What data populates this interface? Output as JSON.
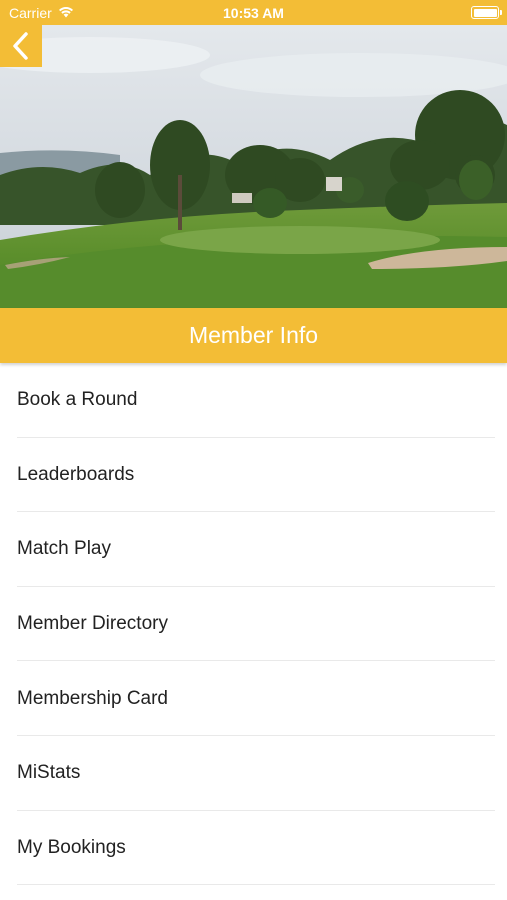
{
  "status_bar": {
    "carrier": "Carrier",
    "time": "10:53 AM"
  },
  "icons": {
    "wifi": "wifi-icon",
    "battery": "battery-icon",
    "back": "chevron-left-icon"
  },
  "colors": {
    "accent": "#f3bd36",
    "text": "#222222",
    "divider": "#e9e9e9"
  },
  "header": {
    "title": "Member Info"
  },
  "menu": {
    "items": [
      {
        "label": "Book a Round"
      },
      {
        "label": "Leaderboards"
      },
      {
        "label": "Match Play"
      },
      {
        "label": "Member Directory"
      },
      {
        "label": "Membership Card"
      },
      {
        "label": "MiStats"
      },
      {
        "label": "My Bookings"
      }
    ]
  }
}
